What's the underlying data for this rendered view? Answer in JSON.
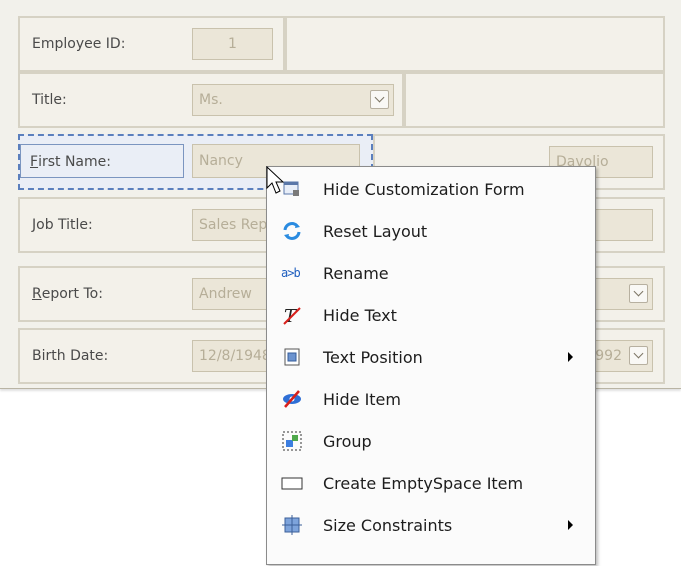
{
  "form": {
    "employee_id": {
      "label": "Employee ID:",
      "value": "1"
    },
    "title": {
      "label": "Title:",
      "value": "Ms."
    },
    "first_name": {
      "label_first": "F",
      "label_rest": "irst Name:",
      "value": "Nancy"
    },
    "last_name_value": "Davolio",
    "job_title": {
      "label": "Job Title:",
      "value": "Sales Representative"
    },
    "report_to": {
      "label_first": "R",
      "label_rest": "eport To:",
      "value": "Andrew"
    },
    "birth_date": {
      "label": "Birth Date:",
      "value": "12/8/1948",
      "hire_date_value": "4/1/1992"
    }
  },
  "menu": {
    "items": [
      {
        "label": "Hide Customization Form",
        "icon": "hide-customization-form-icon"
      },
      {
        "label": "Reset Layout",
        "icon": "reset-layout-icon"
      },
      {
        "label": "Rename",
        "icon": "rename-icon",
        "icon_text": "a>b"
      },
      {
        "label": "Hide Text",
        "icon": "hide-text-icon"
      },
      {
        "label": "Text Position",
        "icon": "text-position-icon",
        "submenu": true
      },
      {
        "label": "Hide Item",
        "icon": "hide-item-icon"
      },
      {
        "label": "Group",
        "icon": "group-icon"
      },
      {
        "label": "Create EmptySpace Item",
        "icon": "empty-space-icon"
      },
      {
        "label": "Size Constraints",
        "icon": "size-constraints-icon",
        "submenu": true
      }
    ]
  },
  "colors": {
    "accent": "#1e6fd8",
    "selection": "#5b7fbd"
  }
}
